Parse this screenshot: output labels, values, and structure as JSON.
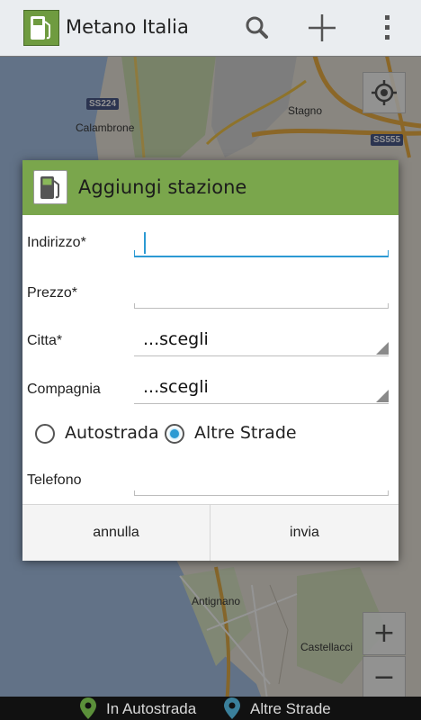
{
  "action_bar": {
    "title": "Metano Italia",
    "icons": [
      "app-logo-icon",
      "search-icon",
      "add-icon",
      "overflow-menu-icon"
    ]
  },
  "map": {
    "labels": {
      "calambrone": "Calambrone",
      "stagno": "Stagno",
      "antignano": "Antignano",
      "castellaccio": "Castellacci"
    },
    "road_shields": {
      "ss224": "SS224",
      "ss555": "SS555"
    },
    "controls": {
      "locate_icon": "my-location-icon",
      "zoom_in": "+",
      "zoom_out": "−"
    }
  },
  "dialog": {
    "title": "Aggiungi stazione",
    "fields": {
      "indirizzo_label": "Indirizzo*",
      "indirizzo_value": "",
      "prezzo_label": "Prezzo*",
      "prezzo_value": "",
      "citta_label": "Citta*",
      "citta_value": "...scegli",
      "compagnia_label": "Compagnia",
      "compagnia_value": "...scegli",
      "telefono_label": "Telefono",
      "telefono_value": ""
    },
    "radio": {
      "autostrada_label": "Autostrada",
      "altre_strade_label": "Altre Strade",
      "selected": "Altre Strade"
    },
    "buttons": {
      "cancel": "annulla",
      "submit": "invia"
    }
  },
  "legend": {
    "in_autostrada": "In Autostrada",
    "altre_strade": "Altre Strade",
    "in_autostrada_color": "#5b8f3a",
    "altre_strade_color": "#3a7f9a"
  },
  "colors": {
    "accent": "#2c9ad3",
    "dialog_header": "#7aa64c"
  }
}
